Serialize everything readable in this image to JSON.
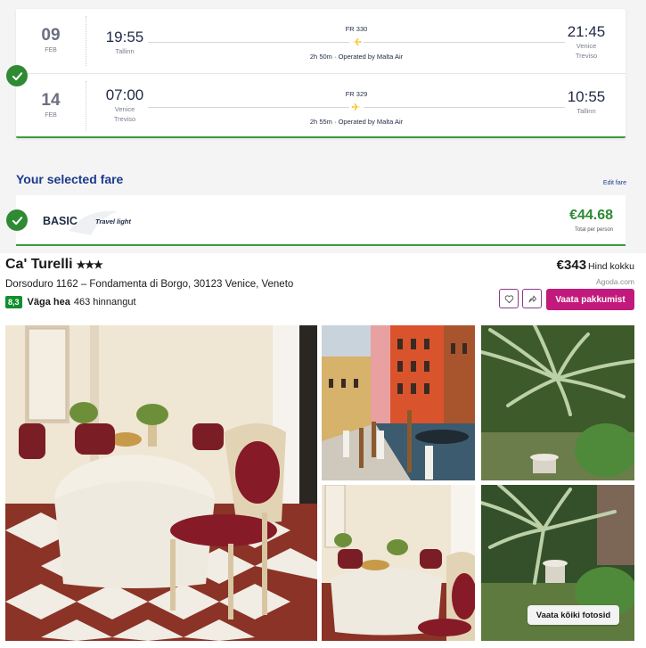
{
  "outbound": {
    "day": "09",
    "month": "FEB",
    "dep_time": "19:55",
    "dep_city": "Tallinn",
    "flight_no": "FR 330",
    "duration": "2h 50m · Operated by Malta Air",
    "arr_time": "21:45",
    "arr_city_1": "Venice",
    "arr_city_2": "Treviso"
  },
  "return": {
    "day": "14",
    "month": "FEB",
    "dep_time": "07:00",
    "dep_city_1": "Venice",
    "dep_city_2": "Treviso",
    "flight_no": "FR 329",
    "duration": "2h 55m · Operated by Malta Air",
    "arr_time": "10:55",
    "arr_city": "Tallinn"
  },
  "fare": {
    "section_title": "Your selected fare",
    "edit_label": "Edit fare",
    "name": "BASIC",
    "subtitle": "Travel light",
    "price": "€44.68",
    "price_note": "Total per person"
  },
  "hotel": {
    "name": "Ca' Turelli",
    "stars": "★★★",
    "address": "Dorsoduro 1162 – Fondamenta di Borgo, 30123 Venice, Veneto",
    "score": "8,3",
    "rating_label": "Väga hea",
    "reviews": "463 hinnangut",
    "price": "€343",
    "price_label": "Hind kokku",
    "provider": "Agoda.com",
    "deals_button": "Vaata pakkumist",
    "all_photos_button": "Vaata kõiki fotosid"
  },
  "colors": {
    "accent_green": "#2f8a33",
    "brand_blue": "#1b3a8c",
    "deals_magenta": "#c21a7c",
    "score_green": "#108f2e"
  },
  "icons": [
    "check-icon",
    "plane-icon",
    "heart-icon",
    "share-icon"
  ]
}
